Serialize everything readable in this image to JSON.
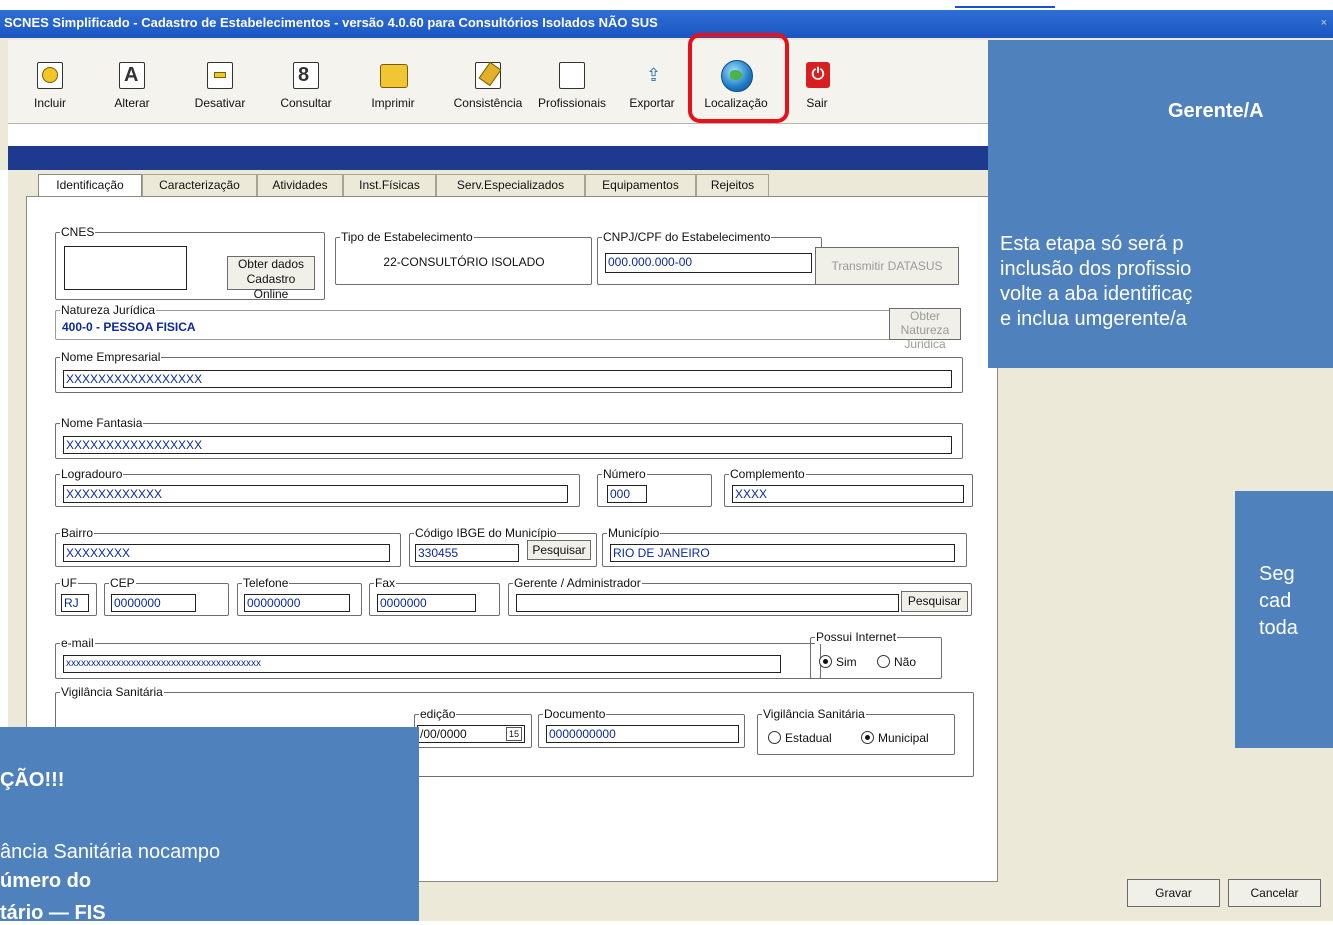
{
  "window": {
    "title": "SCNES Simplificado - Cadastro de Estabelecimentos - versão 4.0.60 para Consultórios Isolados NÃO SUS",
    "close": "×"
  },
  "toolbar": {
    "items": [
      {
        "label": "Incluir",
        "icon": "include-icon"
      },
      {
        "label": "Alterar",
        "icon": "edit-icon"
      },
      {
        "label": "Desativar",
        "icon": "deactivate-icon"
      },
      {
        "label": "Consultar",
        "icon": "search-icon"
      },
      {
        "label": "Imprimir",
        "icon": "printer-icon"
      },
      {
        "label": "Consistência",
        "icon": "consistency-icon"
      },
      {
        "label": "Profissionais",
        "icon": "professionals-icon"
      },
      {
        "label": "Exportar",
        "icon": "export-icon"
      },
      {
        "label": "Localização",
        "icon": "globe-icon"
      },
      {
        "label": "Sair",
        "icon": "exit-icon"
      }
    ],
    "highlight_color": "#e8101b"
  },
  "tabs": [
    "Identificação",
    "Caracterização",
    "Atividades",
    "Inst.Físicas",
    "Serv.Especializados",
    "Equipamentos",
    "Rejeitos"
  ],
  "form": {
    "cnes": {
      "label": "CNES",
      "value": ""
    },
    "obter_cadastro": "Obter dados Cadastro Online",
    "tipo": {
      "label": "Tipo de Estabelecimento",
      "value": "22-CONSULTÓRIO ISOLADO"
    },
    "cnpj": {
      "label": "CNPJ/CPF do Estabelecimento",
      "value": "000.000.000-00"
    },
    "transmitir": "Transmitir DATASUS",
    "natureza": {
      "label": "Natureza Jurídica",
      "value": "400-0 - PESSOA FISICA"
    },
    "obter_natureza": "Obter Natureza Juridica",
    "nome_empresarial": {
      "label": "Nome Empresarial",
      "value": "XXXXXXXXXXXXXXXXX"
    },
    "nome_fantasia": {
      "label": "Nome Fantasia",
      "value": "XXXXXXXXXXXXXXXXX"
    },
    "logradouro": {
      "label": "Logradouro",
      "value": "XXXXXXXXXXXX"
    },
    "numero": {
      "label": "Número",
      "value": "000"
    },
    "complemento": {
      "label": "Complemento",
      "value": "XXXX"
    },
    "bairro": {
      "label": "Bairro",
      "value": "XXXXXXXX"
    },
    "ibge": {
      "label": "Código IBGE do Município",
      "value": "330455",
      "button": "Pesquisar"
    },
    "municipio": {
      "label": "Município",
      "value": "RIO DE JANEIRO"
    },
    "uf": {
      "label": "UF",
      "value": "RJ"
    },
    "cep": {
      "label": "CEP",
      "value": "0000000"
    },
    "telefone": {
      "label": "Telefone",
      "value": "00000000"
    },
    "fax": {
      "label": "Fax",
      "value": "0000000"
    },
    "gerente": {
      "label": "Gerente / Administrador",
      "value": "",
      "button": "Pesquisar"
    },
    "email": {
      "label": "e-mail",
      "value": "xxxxxxxxxxxxxxxxxxxxxxxxxxxxxxxxxxxxxxx"
    },
    "internet": {
      "label": "Possui Internet",
      "options": [
        "Sim",
        "Não"
      ],
      "selected": "Sim"
    },
    "vigilancia": {
      "label": "Vigilância Sanitária"
    },
    "data_expedicao": {
      "label": "edição",
      "value": "/00/0000",
      "cal": "15"
    },
    "documento": {
      "label": "Documento",
      "value": "0000000000"
    },
    "vig_tipo": {
      "label": "Vigilância Sanitária",
      "options": [
        "Estadual",
        "Municipal"
      ],
      "selected": "Municipal"
    }
  },
  "footer": {
    "gravar": "Gravar",
    "cancelar": "Cancelar"
  },
  "overlays": {
    "top_right": {
      "heading": "Gerente/A",
      "lines": [
        "Esta etapa só será p",
        "inclusão dos profissio",
        "volte a aba identificaç",
        "e inclua umgerente/a"
      ]
    },
    "mid_right": {
      "lines": [
        "Seg",
        "cad",
        "toda"
      ]
    },
    "bottom_left": {
      "title": "ÇÃO!!!",
      "line1": "ância Sanitária nocampo",
      "line2": "úmero do",
      "line3": "tário — FIS"
    }
  }
}
